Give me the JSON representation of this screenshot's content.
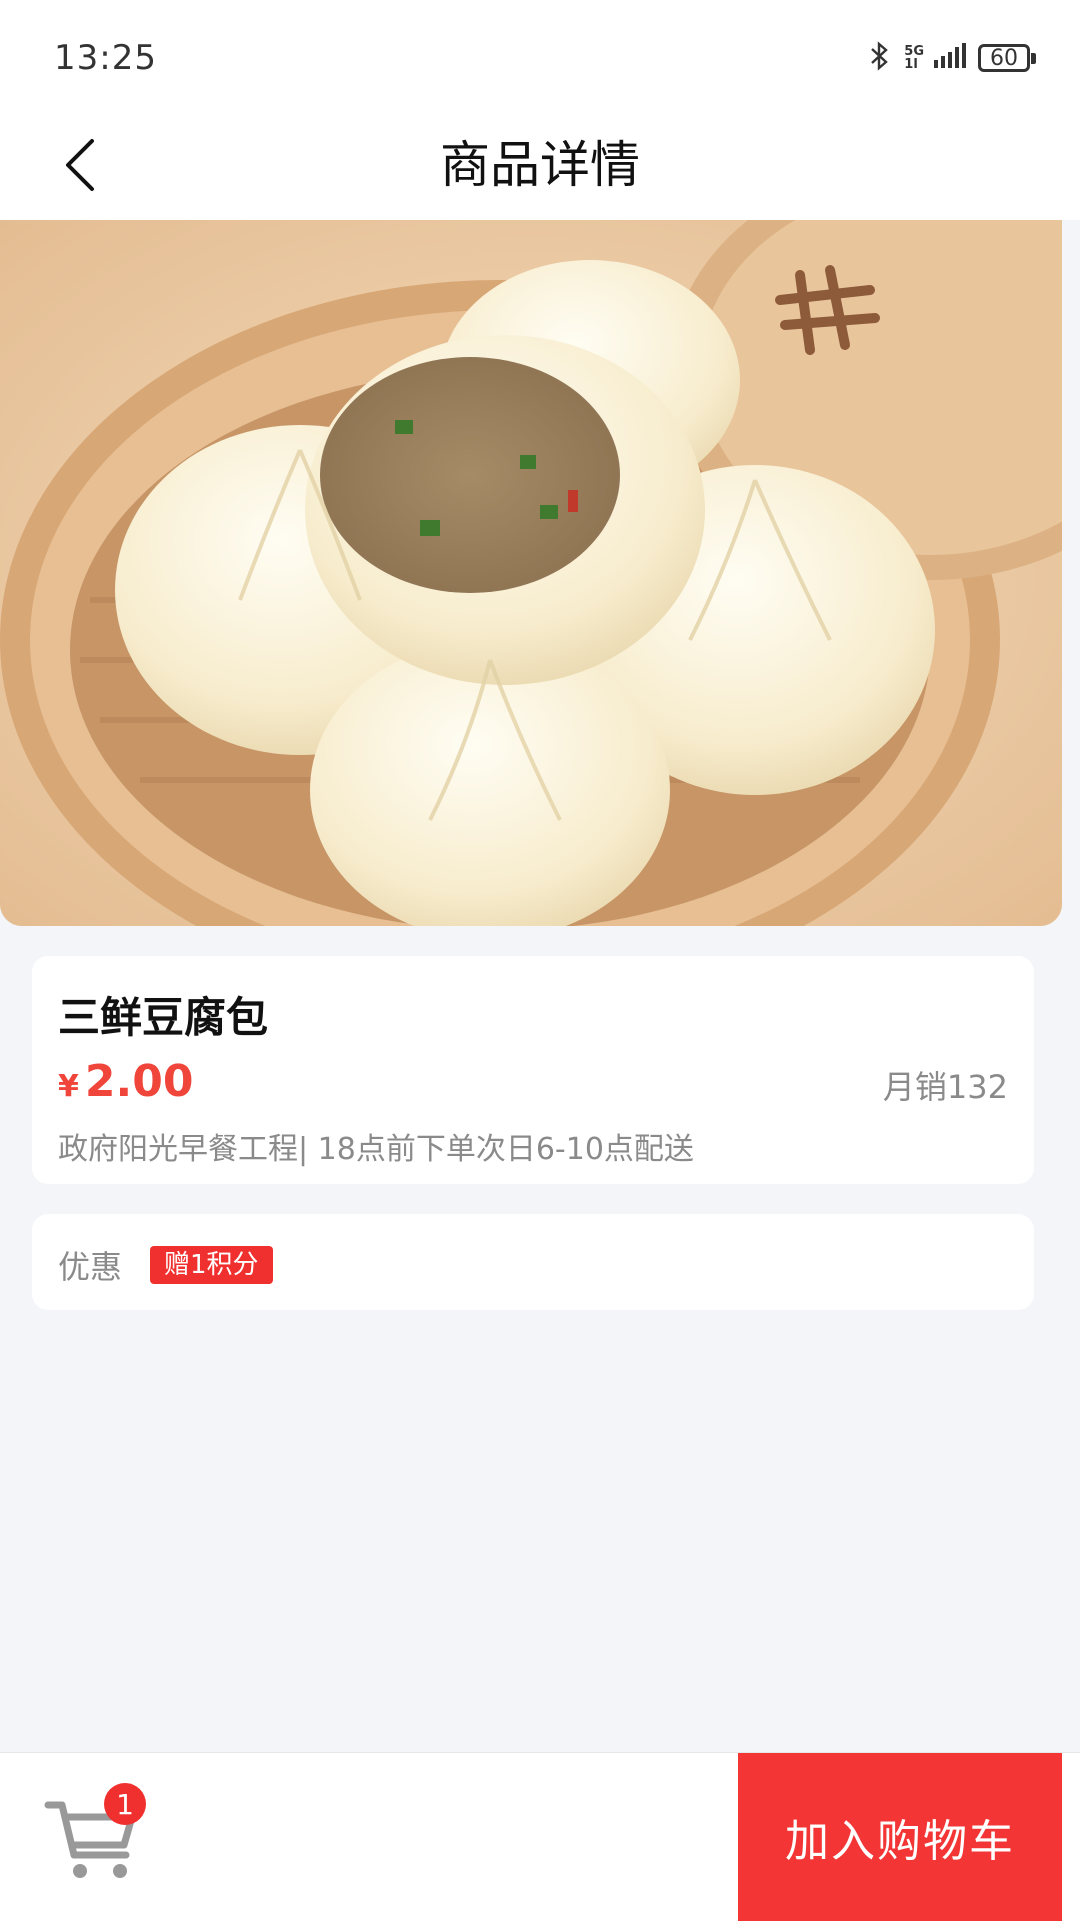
{
  "status_bar": {
    "time": "13:25",
    "network_top": "5G",
    "network_bottom": "1l",
    "battery": "60"
  },
  "nav": {
    "title": "商品详情"
  },
  "product": {
    "name": "三鲜豆腐包",
    "price_symbol": "¥",
    "price": "2.00",
    "monthly_sales": "月销132",
    "description": "政府阳光早餐工程| 18点前下单次日6-10点配送"
  },
  "promo": {
    "label": "优惠",
    "badge": "赠1积分"
  },
  "cart": {
    "count": "1",
    "add_label": "加入购物车"
  },
  "colors": {
    "accent": "#f0453a",
    "button": "#f33535",
    "background": "#f4f5f9"
  }
}
